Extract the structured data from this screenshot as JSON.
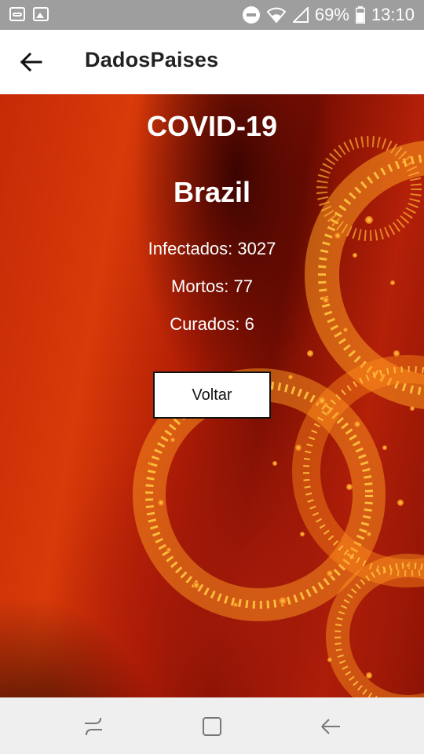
{
  "status_bar": {
    "battery": "69%",
    "time": "13:10",
    "icons": [
      "voicemail-icon",
      "image-icon",
      "do-not-disturb-icon",
      "wifi-icon",
      "signal-icon",
      "battery-icon"
    ]
  },
  "app_bar": {
    "title": "DadosPaises",
    "back_icon": "arrow-left-icon"
  },
  "main": {
    "heading": "COVID-19",
    "country": "Brazil",
    "stats": {
      "infected": "Infectados: 3027",
      "deaths": "Mortos: 77",
      "cured": "Curados: 6"
    },
    "back_button_label": "Voltar"
  },
  "nav_bar": {
    "icons": [
      "recents-icon",
      "home-icon",
      "back-icon"
    ]
  },
  "colors": {
    "status_bar": "#9e9e9e",
    "background_accent": "#d83a09",
    "particle": "#ffb233"
  }
}
